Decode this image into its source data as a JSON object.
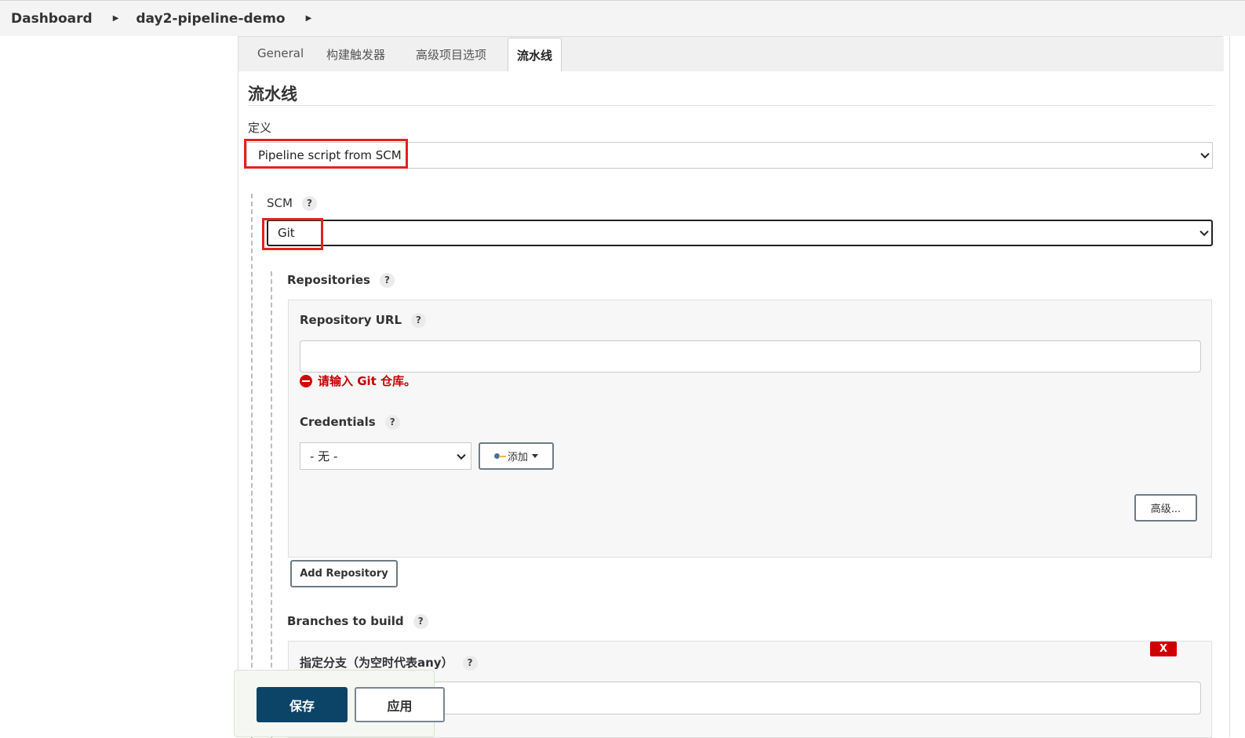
{
  "breadcrumb": {
    "items": [
      "Dashboard",
      "day2-pipeline-demo"
    ]
  },
  "tabs": [
    "General",
    "构建触发器",
    "高级项目选项",
    "流水线"
  ],
  "active_tab": "流水线",
  "section": {
    "title": "流水线"
  },
  "definition": {
    "label": "定义",
    "value": "Pipeline script from SCM"
  },
  "scm": {
    "label": "SCM",
    "value": "Git"
  },
  "repositories": {
    "label": "Repositories",
    "repository_url": {
      "label": "Repository URL",
      "value": "",
      "error": "请输入 Git 仓库。"
    },
    "credentials": {
      "label": "Credentials",
      "value": "- 无 -",
      "add_button": "添加"
    },
    "advanced_button": "高级...",
    "add_repository_button": "Add Repository"
  },
  "branches": {
    "label": "Branches to build",
    "branch_label": "指定分支（为空时代表any）",
    "delete_button": "X",
    "branch_value": ""
  },
  "footer": {
    "save": "保存",
    "apply": "应用"
  },
  "help_glyph": "?",
  "colors": {
    "highlight": "#e2231a",
    "save_bg": "#0c4467",
    "error": "#c40000"
  }
}
